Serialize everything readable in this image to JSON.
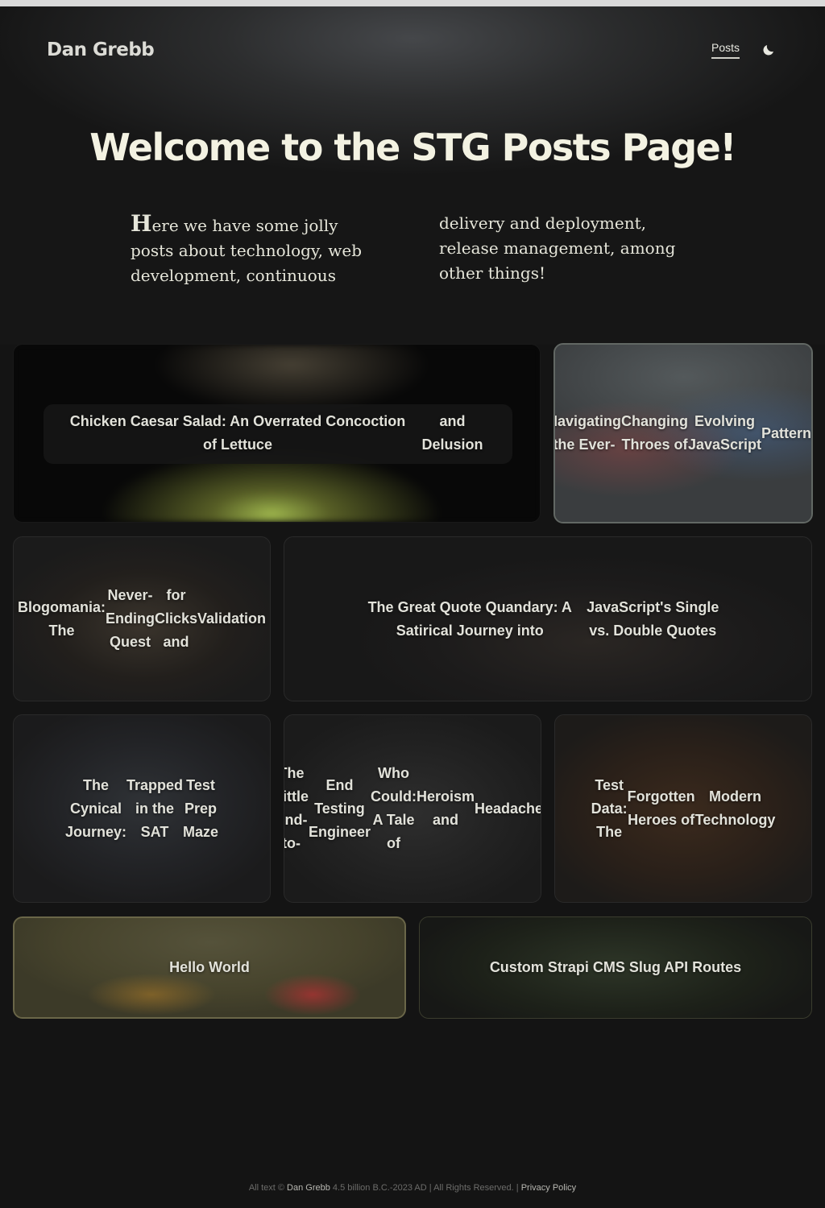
{
  "header": {
    "brand": "Dan Grebb",
    "nav": {
      "posts": "Posts"
    },
    "theme_toggle_icon": "moon-icon"
  },
  "hero": {
    "title": "Welcome to the STG Posts Page!",
    "intro": "Here we have some jolly posts about technology, web development, continuous delivery and deployment, release management, among other things!"
  },
  "posts": [
    {
      "lines": [
        "Chicken Caesar Salad: An Overrated Concoction of Lettuce",
        "and Delusion"
      ]
    },
    {
      "lines": [
        "Navigating the Ever-",
        "Changing Throes of",
        "Evolving JavaScript",
        "Patterns"
      ]
    },
    {
      "lines": [
        "Blogomania: The",
        "Never-Ending Quest",
        "for Clicks and",
        "Validation"
      ]
    },
    {
      "lines": [
        "The Great Quote Quandary: A Satirical Journey into",
        "JavaScript's Single vs. Double Quotes"
      ]
    },
    {
      "lines": [
        "The Cynical Journey:",
        "Trapped in the SAT",
        "Test Prep Maze"
      ]
    },
    {
      "lines": [
        "The Little End-to-",
        "End Testing Engineer",
        "Who Could: A Tale of",
        "Heroism and",
        "Headaches"
      ]
    },
    {
      "lines": [
        "Test Data: The",
        "Forgotten Heroes of",
        "Modern Technology"
      ]
    },
    {
      "lines": [
        "Hello World"
      ]
    },
    {
      "lines": [
        "Custom Strapi CMS Slug API Routes"
      ]
    }
  ],
  "footer": {
    "prefix": "All text ©",
    "author": "Dan Grebb",
    "middle": "4.5 billion B.C.-2023 AD | All Rights Reserved. |",
    "privacy": "Privacy Policy"
  },
  "colors": {
    "background": "#141414",
    "title": "#f3f2e2",
    "highlight_card_border": "#626864"
  }
}
